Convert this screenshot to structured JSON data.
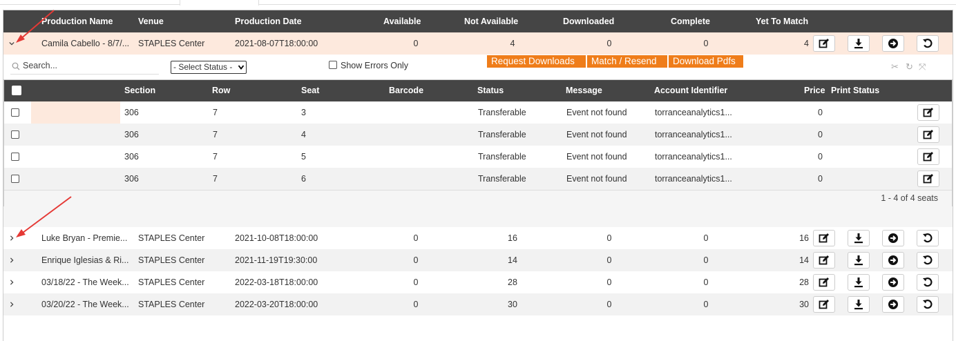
{
  "columns": [
    "Production Name",
    "Venue",
    "Production Date",
    "Available",
    "Not Available",
    "Downloaded",
    "Complete",
    "Yet To Match"
  ],
  "productions": [
    {
      "name": "Camila Cabello - 8/7/...",
      "venue": "STAPLES Center",
      "date": "2021-08-07T18:00:00",
      "available": "0",
      "not_available": "4",
      "downloaded": "0",
      "complete": "0",
      "yet_to_match": "4",
      "expanded": true
    },
    {
      "name": "Luke Bryan - Premie...",
      "venue": "STAPLES Center",
      "date": "2021-10-08T18:00:00",
      "available": "0",
      "not_available": "16",
      "downloaded": "0",
      "complete": "0",
      "yet_to_match": "16",
      "expanded": false
    },
    {
      "name": "Enrique Iglesias & Ri...",
      "venue": "STAPLES Center",
      "date": "2021-11-19T19:30:00",
      "available": "0",
      "not_available": "14",
      "downloaded": "0",
      "complete": "0",
      "yet_to_match": "14",
      "expanded": false
    },
    {
      "name": "03/18/22 - The Week...",
      "venue": "STAPLES Center",
      "date": "2022-03-18T18:00:00",
      "available": "0",
      "not_available": "28",
      "downloaded": "0",
      "complete": "0",
      "yet_to_match": "28",
      "expanded": false
    },
    {
      "name": "03/20/22 - The Week...",
      "venue": "STAPLES Center",
      "date": "2022-03-20T18:00:00",
      "available": "0",
      "not_available": "30",
      "downloaded": "0",
      "complete": "0",
      "yet_to_match": "30",
      "expanded": false
    }
  ],
  "toolbar": {
    "search_placeholder": "Search...",
    "status_select": "- Select Status -",
    "show_errors_label": "Show Errors Only",
    "request_downloads": "Request Downloads",
    "match_resend": "Match / Resend",
    "download_pdfs": "Download Pdfs"
  },
  "seat_columns": [
    "Section",
    "Row",
    "Seat",
    "Barcode",
    "Status",
    "Message",
    "Account Identifier",
    "Price",
    "Print Status"
  ],
  "seats": [
    {
      "section": "306",
      "row": "7",
      "seat": "3",
      "barcode": "",
      "status": "Transferable",
      "message": "Event not found",
      "account": "torranceanalytics1...",
      "price": "0",
      "print_status": ""
    },
    {
      "section": "306",
      "row": "7",
      "seat": "4",
      "barcode": "",
      "status": "Transferable",
      "message": "Event not found",
      "account": "torranceanalytics1...",
      "price": "0",
      "print_status": ""
    },
    {
      "section": "306",
      "row": "7",
      "seat": "5",
      "barcode": "",
      "status": "Transferable",
      "message": "Event not found",
      "account": "torranceanalytics1...",
      "price": "0",
      "print_status": ""
    },
    {
      "section": "306",
      "row": "7",
      "seat": "6",
      "barcode": "",
      "status": "Transferable",
      "message": "Event not found",
      "account": "torranceanalytics1...",
      "price": "0",
      "print_status": ""
    }
  ],
  "pager_text": "1 - 4 of 4 seats",
  "colors": {
    "header_bg": "#454545",
    "accent_orange": "#ef7d1a",
    "expanded_row_bg": "#fde9dd",
    "annotation_arrow": "#e53935"
  }
}
